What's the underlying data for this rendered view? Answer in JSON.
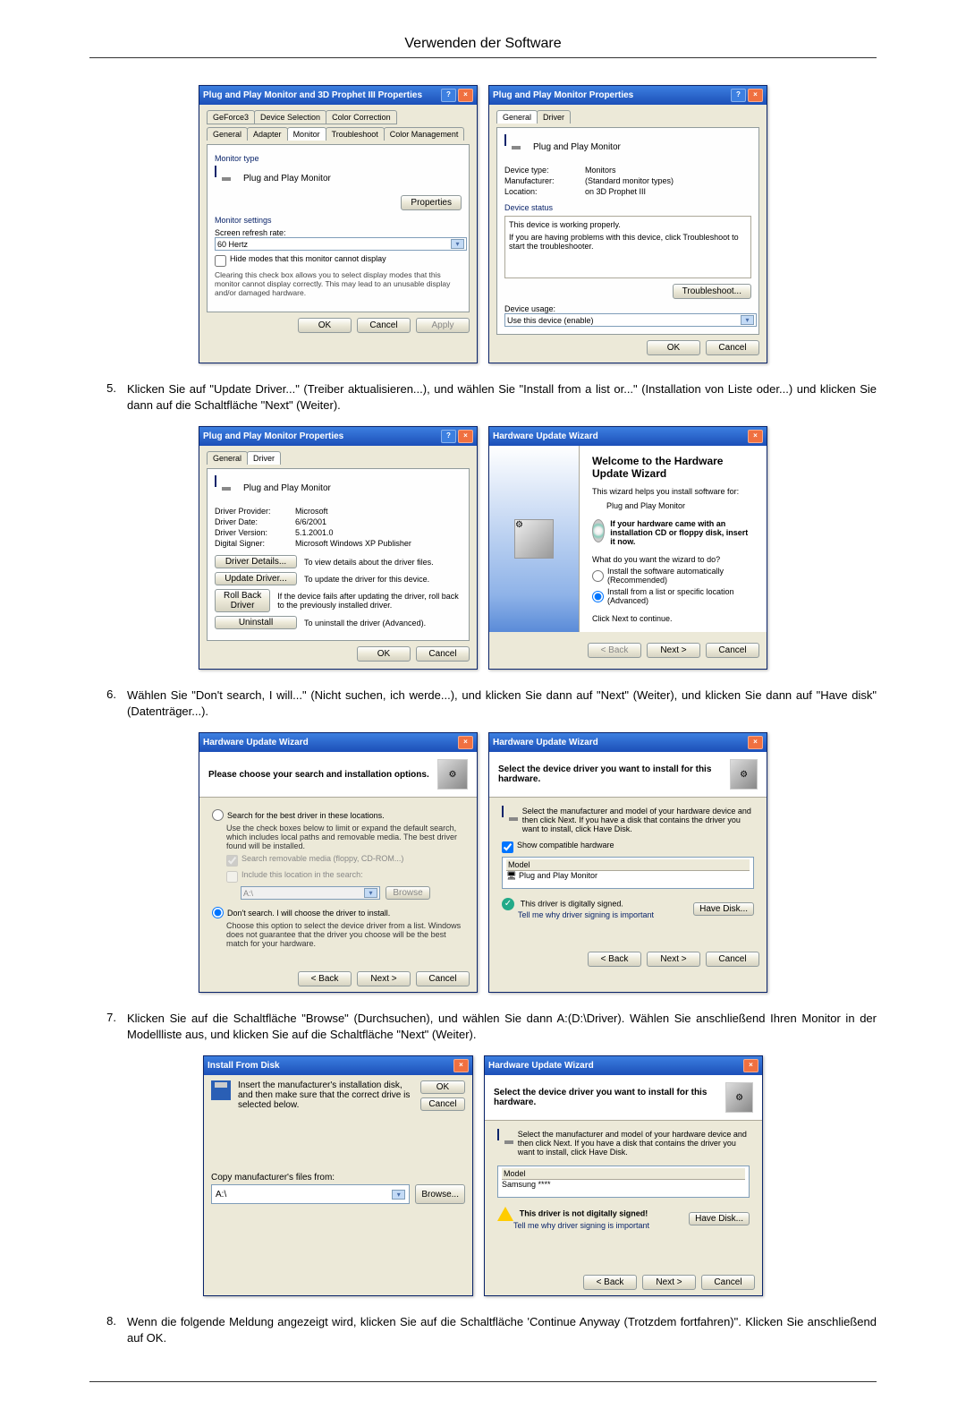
{
  "page_title": "Verwenden der Software",
  "steps": {
    "5": {
      "num": "5.",
      "text": "Klicken Sie auf \"Update Driver...\" (Treiber aktualisieren...), und wählen Sie \"Install from a list or...\" (Installation von Liste oder...) und klicken Sie dann auf die Schaltfläche \"Next\" (Weiter)."
    },
    "6": {
      "num": "6.",
      "text": "Wählen Sie \"Don't search, I will...\" (Nicht suchen, ich werde...), und klicken Sie dann auf \"Next\" (Weiter), und klicken Sie dann auf \"Have disk\" (Datenträger...)."
    },
    "7": {
      "num": "7.",
      "text": "Klicken Sie auf die Schaltfläche \"Browse\" (Durchsuchen), und wählen Sie dann A:(D:\\Driver). Wählen Sie anschließend Ihren Monitor in der Modellliste aus, und klicken Sie auf die Schaltfläche \"Next\" (Weiter)."
    },
    "8": {
      "num": "8.",
      "text": "Wenn die folgende Meldung angezeigt wird, klicken Sie auf die Schaltfläche 'Continue Anyway (Trotzdem fortfahren)\". Klicken Sie anschließend auf OK."
    }
  },
  "win1": {
    "title": "Plug and Play Monitor and 3D Prophet III Properties",
    "tabs_top": [
      "GeForce3",
      "Device Selection",
      "Color Correction"
    ],
    "tabs_bot": [
      "General",
      "Adapter",
      "Monitor",
      "Troubleshoot",
      "Color Management"
    ],
    "group1": "Monitor type",
    "mon_name": "Plug and Play Monitor",
    "properties_btn": "Properties",
    "group2": "Monitor settings",
    "refresh_lbl": "Screen refresh rate:",
    "refresh_val": "60 Hertz",
    "hide_chk": "Hide modes that this monitor cannot display",
    "hide_desc": "Clearing this check box allows you to select display modes that this monitor cannot display correctly. This may lead to an unusable display and/or damaged hardware.",
    "ok": "OK",
    "cancel": "Cancel",
    "apply": "Apply"
  },
  "win2": {
    "title": "Plug and Play Monitor Properties",
    "tabs": [
      "General",
      "Driver"
    ],
    "mon_name": "Plug and Play Monitor",
    "f1l": "Device type:",
    "f1v": "Monitors",
    "f2l": "Manufacturer:",
    "f2v": "(Standard monitor types)",
    "f3l": "Location:",
    "f3v": "on 3D Prophet III",
    "status_grp": "Device status",
    "status1": "This device is working properly.",
    "status2": "If you are having problems with this device, click Troubleshoot to start the troubleshooter.",
    "troubleshoot": "Troubleshoot...",
    "usage_lbl": "Device usage:",
    "usage_val": "Use this device (enable)",
    "ok": "OK",
    "cancel": "Cancel"
  },
  "win3": {
    "title": "Plug and Play Monitor Properties",
    "tabs": [
      "General",
      "Driver"
    ],
    "mon_name": "Plug and Play Monitor",
    "f1l": "Driver Provider:",
    "f1v": "Microsoft",
    "f2l": "Driver Date:",
    "f2v": "6/6/2001",
    "f3l": "Driver Version:",
    "f3v": "5.1.2001.0",
    "f4l": "Digital Signer:",
    "f4v": "Microsoft Windows XP Publisher",
    "b1": "Driver Details...",
    "b1d": "To view details about the driver files.",
    "b2": "Update Driver...",
    "b2d": "To update the driver for this device.",
    "b3": "Roll Back Driver",
    "b3d": "If the device fails after updating the driver, roll back to the previously installed driver.",
    "b4": "Uninstall",
    "b4d": "To uninstall the driver (Advanced).",
    "ok": "OK",
    "cancel": "Cancel"
  },
  "wiz1": {
    "title": "Hardware Update Wizard",
    "h": "Welcome to the Hardware Update Wizard",
    "l1": "This wizard helps you install software for:",
    "l2": "Plug and Play Monitor",
    "cd_hint": "If your hardware came with an installation CD or floppy disk, insert it now.",
    "q": "What do you want the wizard to do?",
    "r1": "Install the software automatically (Recommended)",
    "r2": "Install from a list or specific location (Advanced)",
    "l3": "Click Next to continue.",
    "back": "< Back",
    "next": "Next >",
    "cancel": "Cancel"
  },
  "wiz2": {
    "title": "Hardware Update Wizard",
    "h": "Please choose your search and installation options.",
    "r1": "Search for the best driver in these locations.",
    "r1d": "Use the check boxes below to limit or expand the default search, which includes local paths and removable media. The best driver found will be installed.",
    "c1": "Search removable media (floppy, CD-ROM...)",
    "c2": "Include this location in the search:",
    "loc": "A:\\",
    "browse": "Browse",
    "r2": "Don't search. I will choose the driver to install.",
    "r2d": "Choose this option to select the device driver from a list. Windows does not guarantee that the driver you choose will be the best match for your hardware.",
    "back": "< Back",
    "next": "Next >",
    "cancel": "Cancel"
  },
  "wiz3": {
    "title": "Hardware Update Wizard",
    "h": "Select the device driver you want to install for this hardware.",
    "desc": "Select the manufacturer and model of your hardware device and then click Next. If you have a disk that contains the driver you want to install, click Have Disk.",
    "chk": "Show compatible hardware",
    "col": "Model",
    "row": "Plug and Play Monitor",
    "signed": "This driver is digitally signed.",
    "tell": "Tell me why driver signing is important",
    "havedisk": "Have Disk...",
    "back": "< Back",
    "next": "Next >",
    "cancel": "Cancel"
  },
  "dlg_disk": {
    "title": "Install From Disk",
    "msg": "Insert the manufacturer's installation disk, and then make sure that the correct drive is selected below.",
    "ok": "OK",
    "cancel": "Cancel",
    "copy": "Copy manufacturer's files from:",
    "path": "A:\\",
    "browse": "Browse..."
  },
  "wiz4": {
    "title": "Hardware Update Wizard",
    "h": "Select the device driver you want to install for this hardware.",
    "desc": "Select the manufacturer and model of your hardware device and then click Next. If you have a disk that contains the driver you want to install, click Have Disk.",
    "col": "Model",
    "row": "Samsung ****",
    "signed": "This driver is not digitally signed!",
    "tell": "Tell me why driver signing is important",
    "havedisk": "Have Disk...",
    "back": "< Back",
    "next": "Next >",
    "cancel": "Cancel"
  }
}
